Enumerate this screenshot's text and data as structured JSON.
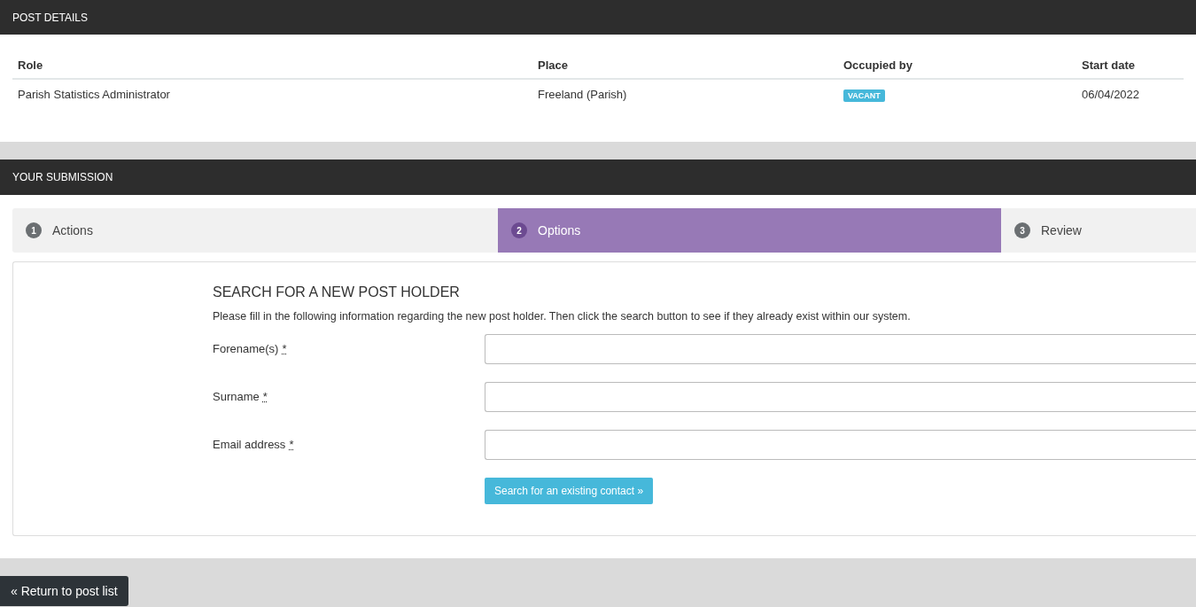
{
  "post_details": {
    "title": "POST DETAILS",
    "columns": [
      "Role",
      "Place",
      "Occupied by",
      "Start date"
    ],
    "rows": [
      {
        "role": "Parish Statistics Administrator",
        "place": "Freeland (Parish)",
        "occupied_by": "VACANT",
        "start_date": "06/04/2022"
      }
    ]
  },
  "submission": {
    "title": "YOUR SUBMISSION",
    "steps": [
      {
        "number": "1",
        "label": "Actions",
        "selected": false
      },
      {
        "number": "2",
        "label": "Options",
        "selected": true
      },
      {
        "number": "3",
        "label": "Review",
        "selected": false
      }
    ],
    "form": {
      "heading": "SEARCH FOR A NEW POST HOLDER",
      "intro": "Please fill in the following information regarding the new post holder. Then click the search button to see if they already exist within our system.",
      "fields": [
        {
          "label": "Forename(s)",
          "required_mark": "*"
        },
        {
          "label": "Surname",
          "required_mark": "*"
        },
        {
          "label": "Email address",
          "required_mark": "*"
        }
      ],
      "search_button": "Search for an existing contact »"
    }
  },
  "return_button": "« Return to post list"
}
